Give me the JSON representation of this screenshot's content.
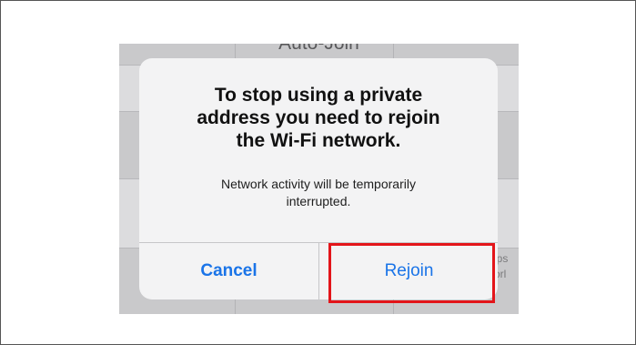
{
  "background": {
    "header_text": "Auto-Join",
    "right_edge_text": [
      "ips",
      "orl"
    ]
  },
  "alert": {
    "title_lines": [
      "To stop using a private",
      "address you need to rejoin",
      "the Wi-Fi network."
    ],
    "message_lines": [
      "Network activity will be temporarily",
      "interrupted."
    ],
    "cancel_label": "Cancel",
    "rejoin_label": "Rejoin"
  },
  "colors": {
    "button_blue": "#1a74e8",
    "highlight_red": "#e3151a"
  }
}
